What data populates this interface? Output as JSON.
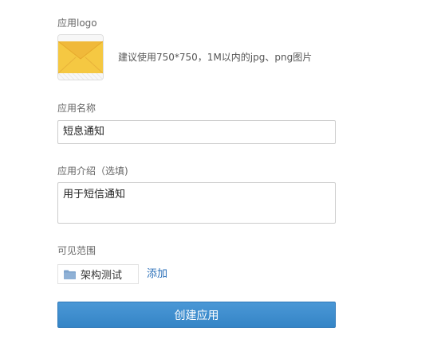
{
  "logo_section": {
    "label": "应用logo",
    "hint": "建议使用750*750，1M以内的jpg、png图片",
    "icon": "envelope-icon"
  },
  "name_section": {
    "label": "应用名称",
    "value": "短息通知"
  },
  "description_section": {
    "label": "应用介绍（选填)",
    "value": "用于短信通知"
  },
  "visibility_section": {
    "label": "可见范围",
    "department": "架构测试",
    "department_icon": "folder-icon",
    "add_label": "添加"
  },
  "actions": {
    "create_label": "创建应用"
  },
  "colors": {
    "primary": "#3a8bcd",
    "link": "#2a6fb8",
    "envelope": "#f5c842"
  }
}
